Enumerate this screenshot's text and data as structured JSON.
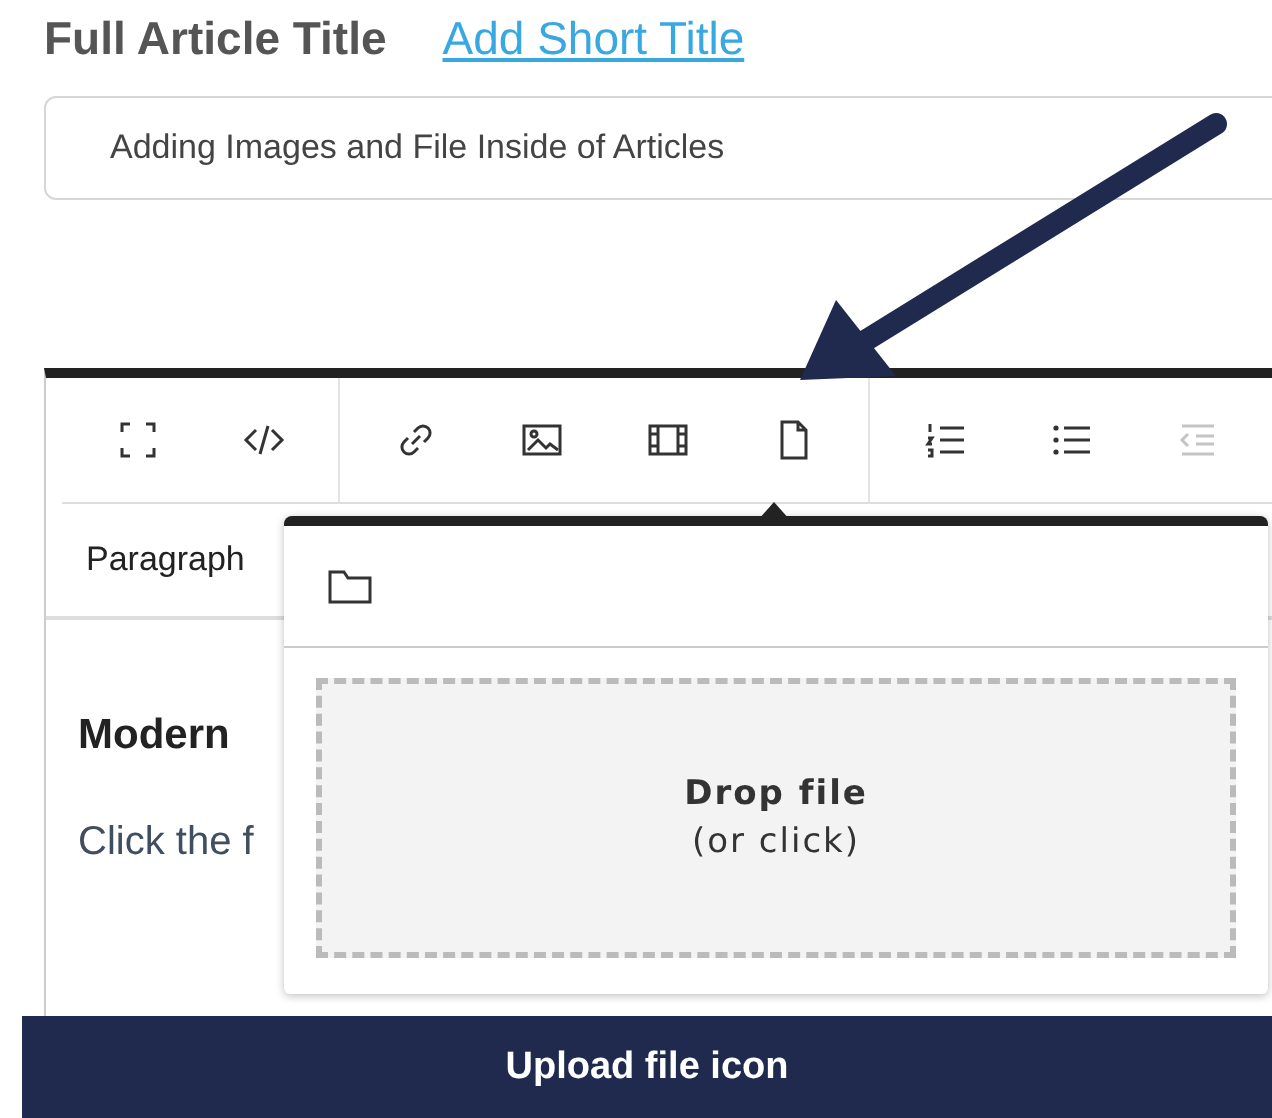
{
  "header": {
    "title": "Full Article Title",
    "link": "Add Short Title"
  },
  "title_field": {
    "value": "Adding Images and File Inside of Articles"
  },
  "toolbar": {
    "groups": [
      [
        {
          "kind": "fullscreen",
          "disabled": false
        },
        {
          "kind": "code",
          "disabled": false
        }
      ],
      [
        {
          "kind": "link",
          "disabled": false
        },
        {
          "kind": "image",
          "disabled": false
        },
        {
          "kind": "video",
          "disabled": false
        },
        {
          "kind": "file",
          "disabled": false
        }
      ],
      [
        {
          "kind": "numbered",
          "disabled": false
        },
        {
          "kind": "bullets",
          "disabled": false
        },
        {
          "kind": "outdent",
          "disabled": true
        }
      ]
    ]
  },
  "format_select": "Paragraph",
  "content": [
    {
      "kind": "heading",
      "text": "Modern"
    },
    {
      "kind": "paragraph",
      "text": "Click the f"
    }
  ],
  "file_popup": {
    "drop_title": "Drop file",
    "drop_hint": "(or click)"
  },
  "caption": "Upload file icon"
}
